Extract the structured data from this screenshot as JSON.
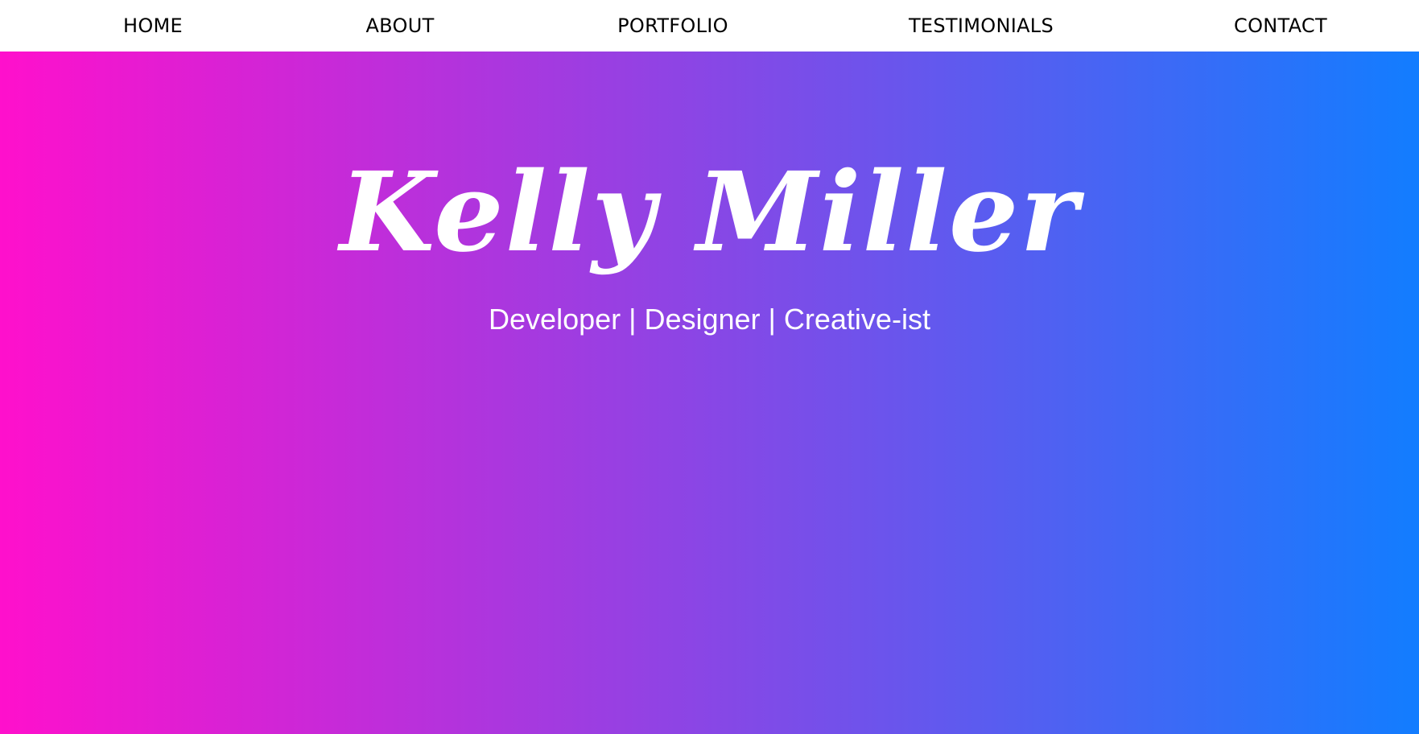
{
  "nav": {
    "items": [
      {
        "label": "HOME"
      },
      {
        "label": "ABOUT"
      },
      {
        "label": "PORTFOLIO"
      },
      {
        "label": "TESTIMONIALS"
      },
      {
        "label": "CONTACT"
      }
    ]
  },
  "hero": {
    "name": "Kelly Miller",
    "tagline": "Developer | Designer | Creative-ist",
    "gradient_start": "#ff10cc",
    "gradient_end": "#127dff"
  },
  "colors": {
    "nav_background": "#ffffff",
    "nav_text": "#000000",
    "hero_text": "#ffffff"
  }
}
